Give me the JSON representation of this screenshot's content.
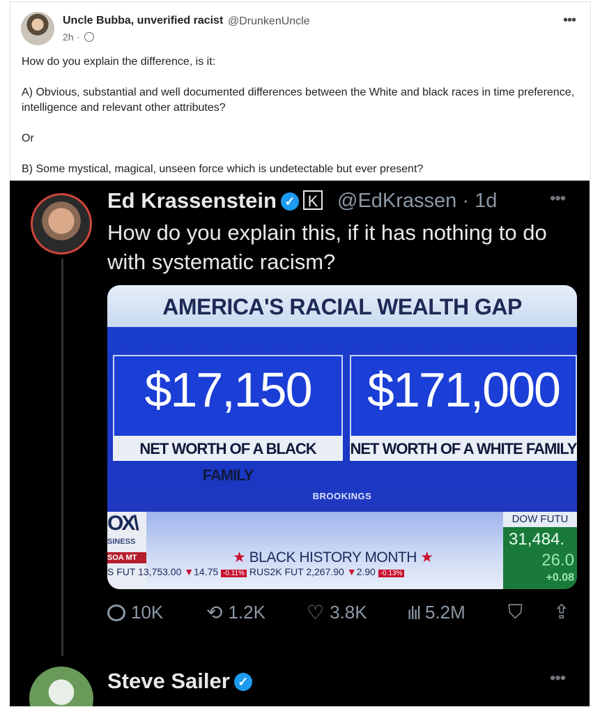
{
  "post": {
    "author_name": "Uncle Bubba, unverified racist",
    "author_handle": "@DrunkenUncle",
    "time": "2h ·",
    "more_label": "•••",
    "paragraphs": [
      "How do you explain the difference, is it:",
      "A) Obvious, substantial and well documented differences between the White and black races in time preference, intelligence and relevant other attributes?",
      "Or",
      "B) Some mystical, magical, unseen force which is undetectable but ever present?"
    ]
  },
  "embedded": {
    "author_name": "Ed Krassenstein",
    "author_handle": "@EdKrassen · 1d",
    "more_label": "•••",
    "text": "How do you explain this, if it has nothing to do with systematic racism?",
    "graphic": {
      "title": "AMERICA'S RACIAL WEALTH GAP",
      "left_value": "$17,150",
      "left_label": "NET WORTH OF A BLACK FAMILY",
      "right_value": "$171,000",
      "right_label": "NET WORTH OF A WHITE FAMILY",
      "source": "BROOKINGS",
      "banner": "BLACK HISTORY MONTH",
      "logo_text": "OX\\",
      "logo_sub": "SINESS",
      "logo_time": "SOA MT",
      "ticker": "S FUT  13,753.00",
      "ticker2": "14.75",
      "ticker_pill1": "-0.11%",
      "ticker3": "RUS2K FUT  2,267.90",
      "ticker4": "2.90",
      "ticker_pill2": "-0.13%",
      "dow_title": "DOW FUTU",
      "dow_value": "31,484.",
      "dow_change": "26.0",
      "dow_pct": "+0.08"
    },
    "actions": {
      "replies": "10K",
      "reposts": "1.2K",
      "likes": "3.8K",
      "views": "5.2M"
    },
    "next_author": "Steve Sailer"
  },
  "colors": {
    "accent": "#1d9bf0",
    "embed_bg": "#000000",
    "tv_blue": "#1b3ed6"
  }
}
